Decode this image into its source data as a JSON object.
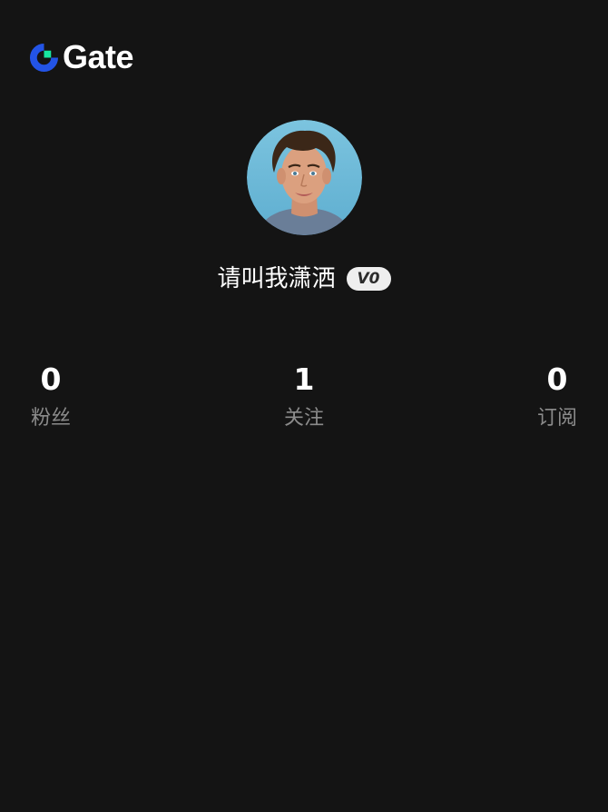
{
  "brand": {
    "name": "Gate",
    "logo_icon": "gate-logo-icon",
    "colors": {
      "blue": "#2354e6",
      "green": "#17e6a1"
    }
  },
  "profile": {
    "avatar_icon": "user-avatar",
    "username": "请叫我潇洒",
    "vip_level": "V0"
  },
  "stats": [
    {
      "value": "0",
      "label": "粉丝"
    },
    {
      "value": "1",
      "label": "关注"
    },
    {
      "value": "0",
      "label": "订阅"
    }
  ],
  "theme": {
    "background": "#141414",
    "text_primary": "#ffffff",
    "text_secondary": "#8b8b8b",
    "badge_bg": "#eeeeee"
  }
}
